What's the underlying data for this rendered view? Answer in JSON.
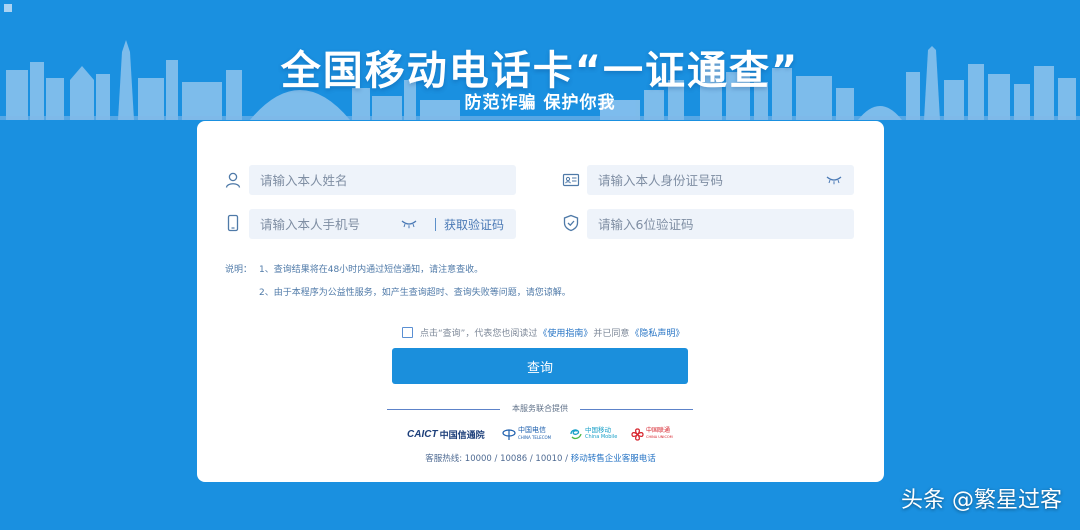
{
  "hero": {
    "title": "全国移动电话卡“一证通查”",
    "subtitle": "防范诈骗 保护你我"
  },
  "form": {
    "name_placeholder": "请输入本人姓名",
    "id_placeholder": "请输入本人身份证号码",
    "phone_placeholder": "请输入本人手机号",
    "get_code_label": "获取验证码",
    "code_placeholder": "请输入6位验证码"
  },
  "notes": {
    "label": "说明：",
    "items": [
      "1、查询结果将在48小时内通过短信通知，请注意查收。",
      "2、由于本程序为公益性服务，如产生查询超时、查询失败等问题，请您谅解。"
    ]
  },
  "agreement": {
    "prefix": "点击“查询”，代表您也阅读过",
    "guide_link": "《使用指南》",
    "middle": "并已同意",
    "privacy_link": "《隐私声明》"
  },
  "query_button": "查询",
  "providers": {
    "label": "本服务联合提供",
    "caict": {
      "mark": "CAICT",
      "name": "中国信通院"
    },
    "telecom": {
      "name": "中国电信",
      "sub": "CHINA TELECOM"
    },
    "mobile": {
      "name": "中国移动",
      "sub": "China Mobile"
    },
    "unicom": {
      "name": "中国联通",
      "sub": "CHINA UNICOM"
    }
  },
  "hotline": {
    "prefix": "客服热线: 10000 / 10086 / 10010 / ",
    "link": "移动转售企业客服电话"
  },
  "watermark": "头条 @繁星过客",
  "colors": {
    "background": "#1a90e0",
    "button": "#1b8fdc",
    "field_bg": "#eef3fa",
    "link": "#2573c4"
  }
}
